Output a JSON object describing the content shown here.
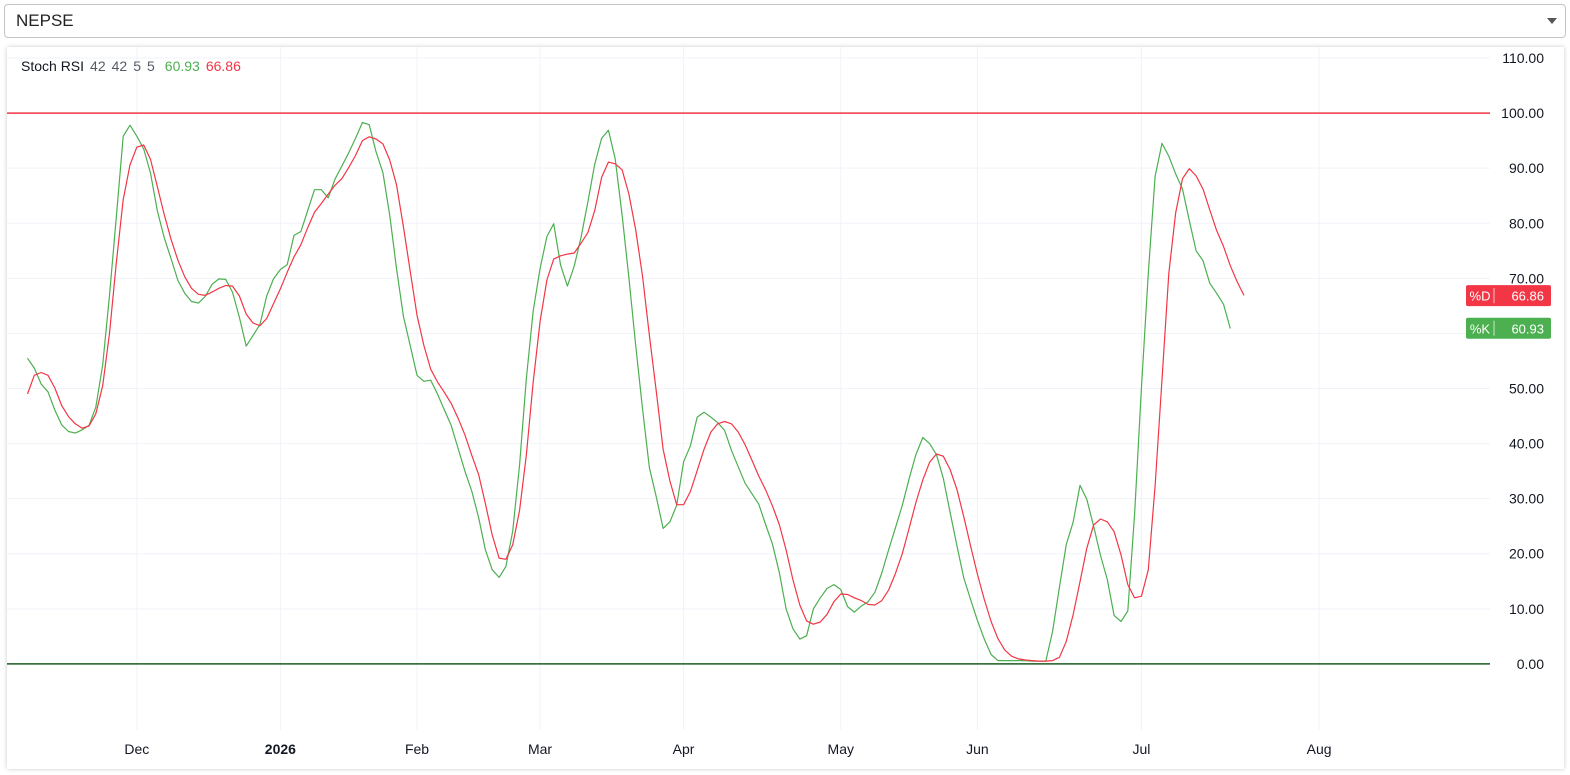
{
  "selector": {
    "value": "NEPSE"
  },
  "legend": {
    "name": "Stoch RSI",
    "params": [
      "42",
      "42",
      "5",
      "5"
    ],
    "k_value": "60.93",
    "d_value": "66.86"
  },
  "colors": {
    "k_line": "#4caf50",
    "d_line": "#f23645",
    "upper_band": "#f23645",
    "lower_band": "#1b5e20",
    "grid": "#f0f3fa"
  },
  "chart_data": {
    "type": "line",
    "ylim": [
      -12,
      112
    ],
    "y_ticks": [
      "110.00",
      "100.00",
      "90.00",
      "80.00",
      "70.00",
      "60.00",
      "50.00",
      "40.00",
      "30.00",
      "20.00",
      "10.00",
      "0.00"
    ],
    "x_ticks": [
      {
        "label": "Dec",
        "x": 16,
        "bold": false
      },
      {
        "label": "2026",
        "x": 37,
        "bold": true
      },
      {
        "label": "Feb",
        "x": 57,
        "bold": false
      },
      {
        "label": "Mar",
        "x": 75,
        "bold": false
      },
      {
        "label": "Apr",
        "x": 96,
        "bold": false
      },
      {
        "label": "May",
        "x": 119,
        "bold": false
      },
      {
        "label": "Jun",
        "x": 139,
        "bold": false
      },
      {
        "label": "Jul",
        "x": 163,
        "bold": false
      },
      {
        "label": "Aug",
        "x": 189,
        "bold": false
      }
    ],
    "x_range": [
      -3,
      214
    ],
    "bands": [
      {
        "value": 100,
        "color": "#f23645"
      },
      {
        "value": 0,
        "color": "#1b5e20"
      }
    ],
    "series": [
      {
        "name": "%K",
        "color": "#4caf50",
        "values": [
          55.5,
          53.7,
          50.8,
          49.4,
          46.1,
          43.4,
          42.2,
          41.9,
          42.5,
          43.3,
          46.6,
          54.3,
          66.9,
          81.1,
          95.8,
          97.8,
          95.8,
          93.5,
          89.1,
          82.2,
          77.4,
          73.6,
          69.6,
          67.3,
          65.8,
          65.5,
          66.7,
          68.9,
          69.9,
          69.8,
          67.5,
          62.9,
          57.7,
          59.6,
          61.6,
          66.8,
          69.9,
          71.6,
          72.5,
          77.8,
          78.5,
          82.3,
          86.1,
          86.1,
          84.6,
          88.0,
          90.4,
          92.8,
          95.4,
          98.3,
          97.9,
          93.0,
          89.2,
          81.5,
          71.8,
          63.1,
          57.8,
          52.4,
          51.3,
          51.5,
          49.0,
          46.1,
          43.3,
          39.1,
          35.0,
          31.4,
          26.6,
          20.7,
          17.1,
          15.7,
          17.7,
          24.1,
          36.2,
          51.9,
          64.1,
          71.8,
          77.6,
          79.9,
          72.4,
          68.6,
          72.2,
          77.5,
          83.9,
          90.7,
          95.4,
          96.9,
          91.7,
          81.5,
          70.1,
          57.8,
          46.2,
          35.6,
          30.4,
          24.6,
          25.8,
          28.8,
          36.7,
          39.6,
          44.8,
          45.7,
          44.8,
          43.8,
          42.4,
          38.8,
          35.8,
          32.8,
          30.9,
          29.0,
          25.3,
          21.8,
          16.6,
          10.0,
          6.4,
          4.5,
          5.1,
          10.0,
          12.0,
          13.7,
          14.4,
          13.5,
          10.4,
          9.4,
          10.5,
          11.3,
          13.0,
          16.5,
          20.7,
          24.7,
          28.8,
          33.6,
          38.0,
          41.1,
          40.0,
          38.0,
          33.7,
          27.5,
          21.5,
          15.6,
          11.7,
          7.9,
          4.5,
          1.7,
          0.6,
          0.6,
          0.6,
          0.6,
          0.6,
          0.5,
          0.5,
          0.5,
          5.9,
          14.0,
          21.7,
          25.7,
          32.4,
          29.9,
          25.0,
          19.7,
          15.3,
          8.8,
          7.7,
          9.6,
          27.2,
          50.3,
          70.9,
          88.5,
          94.5,
          92.2,
          89.0,
          86.2,
          80.5,
          75.0,
          73.2,
          69.1,
          67.3,
          65.3,
          60.9
        ]
      },
      {
        "name": "%D",
        "color": "#f23645",
        "values": [
          49.0,
          52.4,
          52.9,
          52.4,
          50.1,
          46.9,
          44.9,
          43.6,
          42.8,
          43.2,
          45.4,
          50.5,
          60.0,
          72.8,
          84.3,
          90.6,
          93.8,
          94.2,
          91.6,
          86.6,
          81.6,
          77.1,
          73.3,
          70.3,
          68.2,
          67.1,
          66.9,
          67.5,
          68.2,
          68.7,
          68.6,
          66.8,
          63.5,
          61.9,
          61.4,
          62.7,
          65.4,
          68.1,
          71.1,
          73.9,
          76.1,
          79.2,
          82.0,
          83.6,
          85.3,
          86.9,
          88.1,
          90.1,
          92.3,
          95.0,
          95.7,
          95.3,
          94.4,
          91.5,
          87.0,
          79.4,
          71.3,
          63.3,
          57.8,
          53.5,
          51.2,
          49.3,
          47.3,
          44.6,
          41.6,
          37.9,
          34.4,
          29.1,
          23.4,
          19.2,
          19.0,
          21.6,
          27.9,
          38.0,
          51.2,
          62.2,
          69.7,
          73.5,
          74.1,
          74.4,
          74.6,
          76.4,
          78.3,
          82.3,
          88.3,
          91.1,
          90.8,
          89.7,
          85.3,
          78.8,
          70.3,
          59.6,
          49.6,
          39.0,
          33.2,
          28.9,
          28.9,
          31.3,
          35.1,
          39.0,
          42.1,
          43.6,
          44.0,
          43.6,
          42.1,
          39.8,
          37.0,
          34.1,
          31.6,
          28.7,
          25.3,
          20.7,
          15.3,
          10.7,
          7.8,
          7.2,
          7.6,
          9.0,
          11.3,
          12.7,
          12.6,
          12.0,
          11.5,
          10.8,
          10.7,
          11.5,
          13.4,
          16.4,
          20.0,
          24.6,
          29.3,
          33.4,
          36.6,
          38.1,
          37.7,
          35.3,
          31.7,
          26.7,
          21.4,
          16.3,
          11.7,
          7.7,
          4.6,
          2.5,
          1.4,
          0.9,
          0.7,
          0.6,
          0.5,
          0.5,
          0.6,
          1.2,
          4.1,
          8.9,
          14.9,
          21.0,
          25.2,
          26.3,
          25.8,
          24.0,
          19.8,
          14.4,
          12.0,
          12.3,
          17.1,
          32.3,
          51.6,
          70.9,
          81.8,
          88.1,
          89.9,
          88.6,
          86.2,
          82.4,
          78.7,
          75.8,
          72.3,
          69.4,
          66.9
        ]
      }
    ]
  },
  "badges": [
    {
      "label": "%D",
      "value": "66.86",
      "color": "#f23645"
    },
    {
      "label": "%K",
      "value": "60.93",
      "color": "#4caf50"
    }
  ]
}
